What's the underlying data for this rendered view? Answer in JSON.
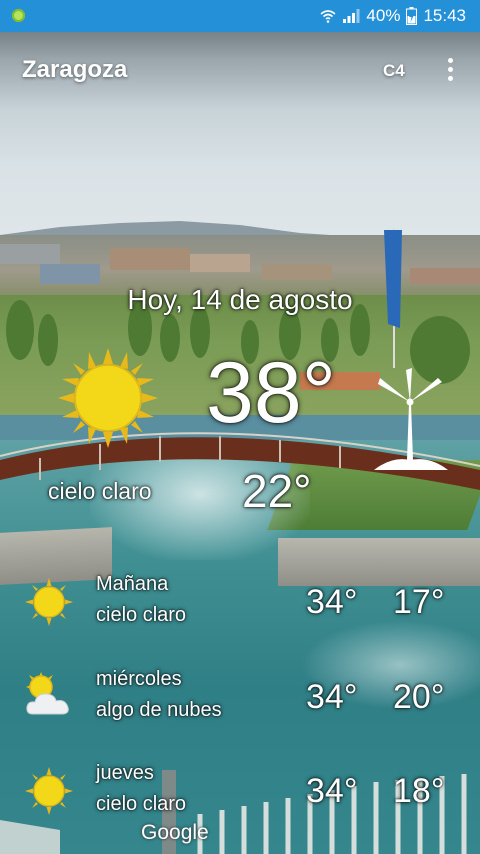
{
  "status_bar": {
    "battery": "40%",
    "time": "15:43"
  },
  "header": {
    "city": "Zaragoza",
    "unit_toggle": "C4",
    "more_icon": "more-vert-icon"
  },
  "today": {
    "date": "Hoy, 14 de agosto",
    "high": "38°",
    "low": "22°",
    "description": "cielo claro",
    "icon": "sun-icon"
  },
  "forecast": [
    {
      "day": "Mañana",
      "description": "cielo claro",
      "high": "34°",
      "low": "17°",
      "icon": "sun-icon"
    },
    {
      "day": "miércoles",
      "description": "algo de nubes",
      "high": "34°",
      "low": "20°",
      "icon": "partly-cloudy-icon"
    },
    {
      "day": "jueves",
      "description": "cielo claro",
      "high": "34°",
      "low": "18°",
      "icon": "sun-icon"
    }
  ],
  "attribution": "Google",
  "colors": {
    "status_bar": "#2390d8",
    "sun": "#f3d81a",
    "sun_rays": "#e8b91a"
  }
}
